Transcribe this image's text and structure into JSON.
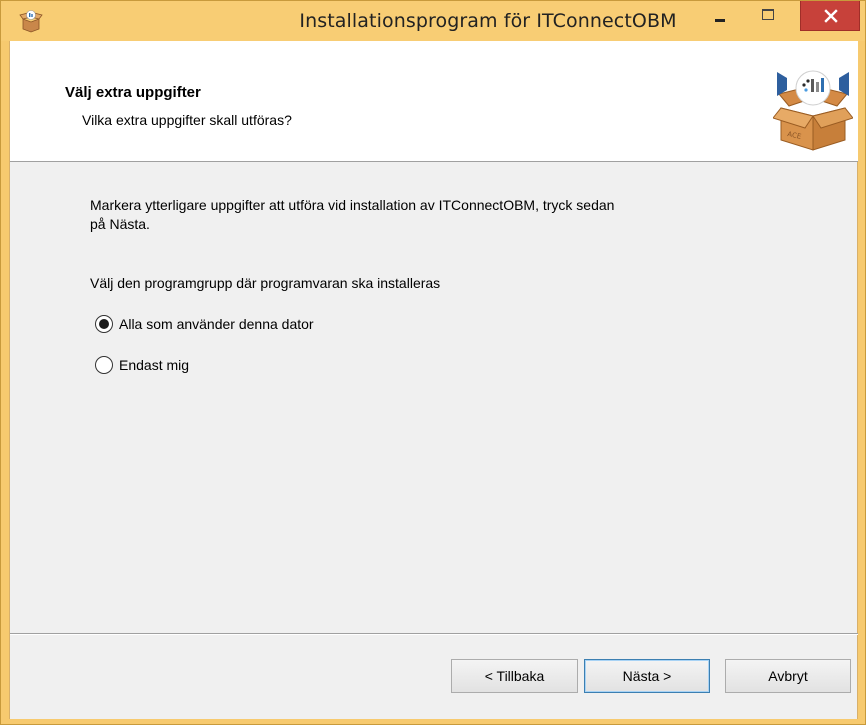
{
  "window": {
    "title": "Installationsprogram för ITConnectOBM",
    "frame_color": "#f7ca6f",
    "close_color": "#c7413a"
  },
  "header": {
    "title": "Välj extra uppgifter",
    "subtitle": "Vilka extra uppgifter skall utföras?"
  },
  "body": {
    "intro_line1": "Markera ytterligare uppgifter att utföra vid installation av ITConnectOBM, tryck sedan",
    "intro_line2": "på Nästa.",
    "group_label": "Välj den programgrupp där programvaran ska installeras",
    "options": [
      {
        "label": "Alla som använder denna dator",
        "selected": true
      },
      {
        "label": "Endast mig",
        "selected": false
      }
    ]
  },
  "buttons": {
    "back": "< Tillbaka",
    "next": "Nästa >",
    "cancel": "Avbryt"
  },
  "icons": {
    "app": "installer-box-icon",
    "logo": "installer-box-logo"
  }
}
